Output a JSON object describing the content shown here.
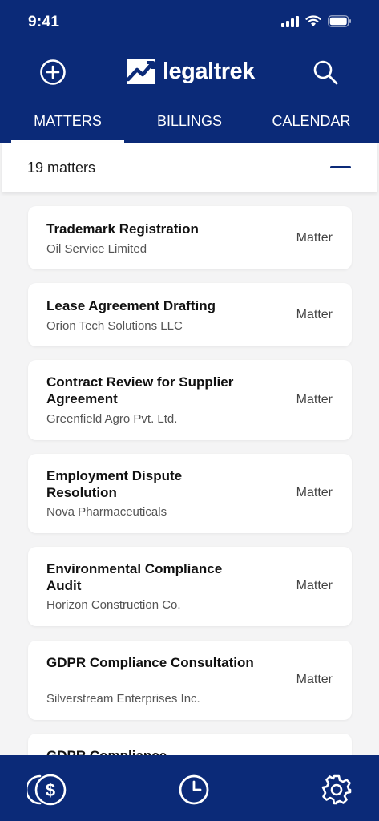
{
  "status_bar": {
    "time": "9:41"
  },
  "app": {
    "logo_text": "legaltrek"
  },
  "tabs": [
    {
      "label": "MATTERS",
      "active": true
    },
    {
      "label": "BILLINGS",
      "active": false
    },
    {
      "label": "CALENDAR",
      "active": false
    }
  ],
  "summary": {
    "count_text": "19 matters"
  },
  "matters": [
    {
      "title": "Trademark Registration",
      "client": "Oil Service Limited",
      "type": "Matter"
    },
    {
      "title": "Lease Agreement Drafting",
      "client": "Orion Tech Solutions LLC",
      "type": "Matter"
    },
    {
      "title": "Contract Review for Supplier Agreement",
      "client": "Greenfield Agro Pvt. Ltd.",
      "type": "Matter"
    },
    {
      "title": "Employment Dispute Resolution",
      "client": "Nova Pharmaceuticals",
      "type": "Matter"
    },
    {
      "title": "Environmental Compliance Audit",
      "client": "Horizon Construction Co.",
      "type": "Matter"
    },
    {
      "title": "GDPR Compliance Consultation",
      "client": "Silverstream Enterprises Inc.",
      "type": "Matter"
    },
    {
      "title": "GDPR Compliance",
      "client": "",
      "type": ""
    }
  ],
  "icons": {
    "add": "plus-circle-icon",
    "search": "search-icon",
    "billing": "coins-dollar-icon",
    "time": "clock-icon",
    "settings": "gear-icon"
  },
  "colors": {
    "primary": "#0b2a78",
    "background": "#f4f4f5",
    "card": "#ffffff"
  }
}
